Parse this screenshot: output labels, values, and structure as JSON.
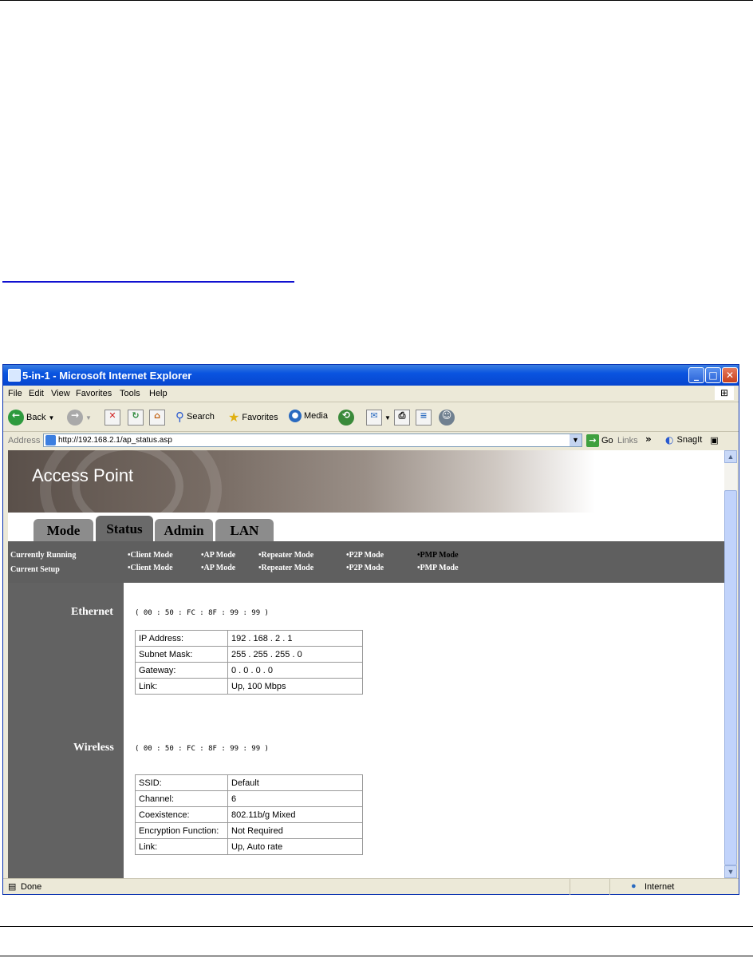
{
  "window": {
    "title": "5-in-1 - Microsoft Internet Explorer",
    "menu": [
      "File",
      "Edit",
      "View",
      "Favorites",
      "Tools",
      "Help"
    ],
    "toolbar": {
      "back": "Back",
      "search": "Search",
      "favorites": "Favorites",
      "media": "Media"
    },
    "address_label": "Address",
    "address_url": "http://192.168.2.1/ap_status.asp",
    "go": "Go",
    "links": "Links",
    "chevron": "»",
    "snagit": "SnagIt",
    "status_left": "Done",
    "status_zone": "Internet"
  },
  "page": {
    "banner_title": "Access Point",
    "tabs": [
      {
        "label": "Mode",
        "active": false
      },
      {
        "label": "Status",
        "active": true
      },
      {
        "label": "Admin",
        "active": false
      },
      {
        "label": "LAN",
        "active": false
      }
    ],
    "mode_rows": [
      {
        "label": "Currently Running",
        "modes": [
          "•Client Mode",
          "•AP Mode",
          "•Repeater Mode",
          "•P2P Mode",
          "•PMP Mode"
        ]
      },
      {
        "label": "Current Setup",
        "modes": [
          "•Client Mode",
          "•AP Mode",
          "•Repeater Mode",
          "•P2P Mode",
          "•PMP Mode"
        ]
      }
    ],
    "ethernet": {
      "title": "Ethernet",
      "mac": "( 00 : 50 : FC : 8F : 99 : 99 )",
      "rows": [
        {
          "key": "IP Address:",
          "value": "192 . 168 . 2 . 1"
        },
        {
          "key": "Subnet Mask:",
          "value": "255 . 255 . 255 . 0"
        },
        {
          "key": "Gateway:",
          "value": "0 . 0 . 0 . 0"
        },
        {
          "key": "Link:",
          "value": "Up, 100 Mbps"
        }
      ]
    },
    "wireless": {
      "title": "Wireless",
      "mac": "( 00 : 50 : FC : 8F : 99 : 99 )",
      "rows": [
        {
          "key": "SSID:",
          "value": "Default"
        },
        {
          "key": "Channel:",
          "value": "6"
        },
        {
          "key": "Coexistence:",
          "value": "802.11b/g Mixed"
        },
        {
          "key": "Encryption Function:",
          "value": "Not Required"
        },
        {
          "key": "Link:",
          "value": "Up,  Auto rate"
        }
      ]
    }
  }
}
